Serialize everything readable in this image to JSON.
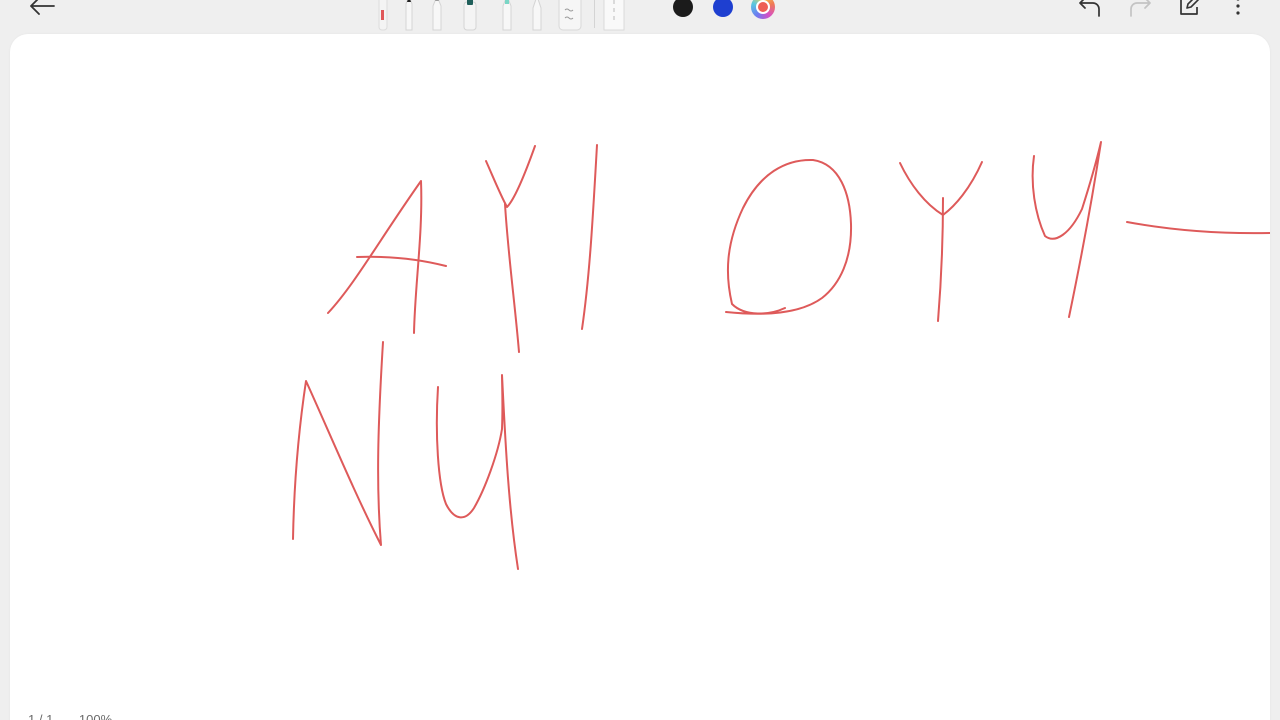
{
  "toolbar": {
    "back": {
      "icon": "arrow-left-icon"
    },
    "undo": {
      "icon": "undo-icon"
    },
    "redo": {
      "icon": "redo-icon",
      "enabled": false
    },
    "edit": {
      "icon": "edit-note-icon"
    },
    "more": {
      "icon": "more-vertical-icon"
    }
  },
  "pens": [
    {
      "name": "pen-red",
      "accent": "#e0585a"
    },
    {
      "name": "pen-fountain",
      "accent": "#222222"
    },
    {
      "name": "pen-pencil",
      "accent": "#9b9b9b"
    },
    {
      "name": "pen-marker",
      "accent": "#1f5f5a"
    },
    {
      "name": "pen-highlighter",
      "accent": "#7ad6c6"
    },
    {
      "name": "pen-calligraphy",
      "accent": "#bdbdbd"
    },
    {
      "name": "eraser",
      "accent": "#cccccc"
    },
    {
      "name": "ruler",
      "accent": "#cccccc"
    }
  ],
  "colors": {
    "black": "#1b1b1b",
    "blue": "#1e3fd0",
    "selected": "#ee5f55"
  },
  "canvas": {
    "ink_color": "#de5a5a"
  },
  "status": {
    "page": "1 / 1",
    "zoom": "100%"
  }
}
